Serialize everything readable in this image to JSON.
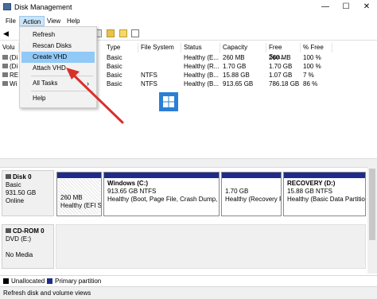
{
  "window": {
    "title": "Disk Management"
  },
  "window_controls": {
    "minimize": "—",
    "maximize": "☐",
    "close": "✕"
  },
  "menu": {
    "file": "File",
    "action": "Action",
    "view": "View",
    "help": "Help"
  },
  "toolbar": {
    "icons": [
      "back-icon",
      "forward-icon",
      "disk-icon",
      "folder-icon",
      "properties-icon"
    ]
  },
  "dropdown": {
    "items": [
      "Refresh",
      "Rescan Disks",
      "Create VHD",
      "Attach VHD",
      "All Tasks",
      "Help"
    ],
    "submenu_arrow": "›"
  },
  "table": {
    "headers": [
      "Volu",
      "Type",
      "File System",
      "Status",
      "Capacity",
      "Free Spa...",
      "% Free"
    ],
    "rows": [
      {
        "vol": "(Di",
        "type": "Basic",
        "fs": "",
        "status": "Healthy (E...",
        "cap": "260 MB",
        "free": "260 MB",
        "pct": "100 %"
      },
      {
        "vol": "(Di",
        "type": "Basic",
        "fs": "",
        "status": "Healthy (R...",
        "cap": "1.70 GB",
        "free": "1.70 GB",
        "pct": "100 %"
      },
      {
        "vol": "RE",
        "type": "Basic",
        "fs": "NTFS",
        "status": "Healthy (B...",
        "cap": "15.88 GB",
        "free": "1.07 GB",
        "pct": "7 %"
      },
      {
        "vol": "Wi",
        "type": "Basic",
        "fs": "NTFS",
        "status": "Healthy (B...",
        "cap": "913.65 GB",
        "free": "786.18 GB",
        "pct": "86 %"
      }
    ]
  },
  "disk0": {
    "name": "Disk 0",
    "type": "Basic",
    "size": "931.50 GB",
    "state": "Online",
    "partitions": [
      {
        "title": "",
        "size": "260 MB",
        "status": "Healthy (EFI Sy"
      },
      {
        "title": "Windows  (C:)",
        "size": "913.65 GB NTFS",
        "status": "Healthy (Boot, Page File, Crash Dump, Ba"
      },
      {
        "title": "",
        "size": "1.70 GB",
        "status": "Healthy (Recovery Pa"
      },
      {
        "title": "RECOVERY  (D:)",
        "size": "15.88 GB NTFS",
        "status": "Healthy (Basic Data Partition"
      }
    ]
  },
  "cdrom0": {
    "name": "CD-ROM 0",
    "type": "DVD (E:)",
    "media": "No Media"
  },
  "legend": {
    "unallocated": "Unallocated",
    "primary": "Primary partition"
  },
  "status": {
    "text": "Refresh disk and volume views"
  },
  "colors": {
    "partition_blue": "#1f2b8c",
    "highlight": "#91c9f7",
    "arrow": "#d9302b"
  }
}
